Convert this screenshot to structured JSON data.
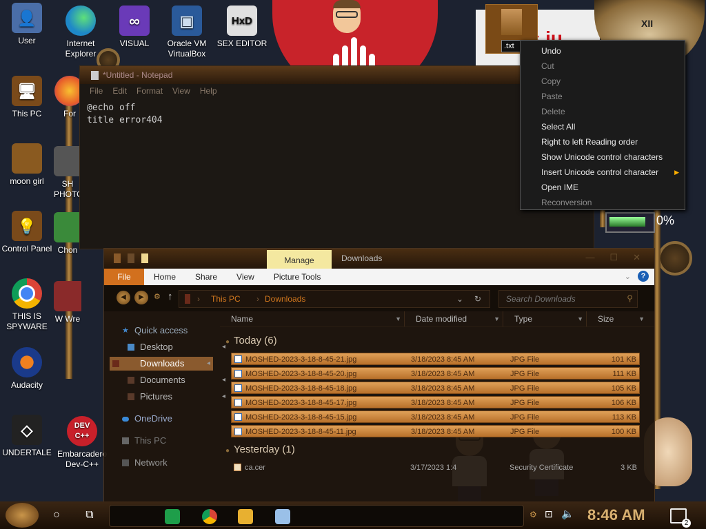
{
  "desktop": {
    "icons": [
      {
        "label": "User",
        "glyph": "👤",
        "color": "#4a6ea8"
      },
      {
        "label": "This PC",
        "glyph": "🖥",
        "color": "#7a4a1a"
      },
      {
        "label": "moon girl",
        "glyph": "",
        "color": "#8a5a20"
      },
      {
        "label": "Control Panel",
        "glyph": "💡",
        "color": "#7a4a1a"
      },
      {
        "label": "THIS IS SPYWARE",
        "glyph": "",
        "color": "#ffffff"
      },
      {
        "label": "Audacity",
        "glyph": "",
        "color": "#1a3a8a"
      },
      {
        "label": "UNDERTALE",
        "glyph": "",
        "color": "#222222"
      },
      {
        "label": "Internet Explorer",
        "glyph": "",
        "color": "#1e88c8"
      },
      {
        "label": "VISUAL",
        "glyph": "∞",
        "color": "#6a3ab8"
      },
      {
        "label": "Oracle VM VirtualBox",
        "glyph": "▣",
        "color": "#2a5a9a"
      },
      {
        "label": "SEX EDITOR",
        "glyph": "HxD",
        "color": "#e0e0e0"
      },
      {
        "label": "For",
        "glyph": "",
        "color": "#e8602a"
      },
      {
        "label": "SH PHOTO",
        "glyph": "",
        "color": "#555555"
      },
      {
        "label": "Chon",
        "glyph": "",
        "color": "#3a8a3a"
      },
      {
        "label": "W Wre",
        "glyph": "",
        "color": "#8a2a2a"
      },
      {
        "label": "Embarcadero Dev-C++",
        "glyph": "DEV C++",
        "color": "#c8202a"
      }
    ],
    "meter_percent": "0%"
  },
  "notepad": {
    "title": "*Untitled - Notepad",
    "menu": [
      "File",
      "Edit",
      "Format",
      "View",
      "Help"
    ],
    "content": "@echo off\ntitle error404"
  },
  "rename": {
    "value": ".txt"
  },
  "context_menu": {
    "items": [
      {
        "label": "Undo",
        "enabled": true,
        "submenu": false
      },
      {
        "label": "Cut",
        "enabled": false,
        "submenu": false
      },
      {
        "label": "Copy",
        "enabled": false,
        "submenu": false
      },
      {
        "label": "Paste",
        "enabled": false,
        "submenu": false
      },
      {
        "label": "Delete",
        "enabled": false,
        "submenu": false
      },
      {
        "label": "Select All",
        "enabled": true,
        "submenu": false
      },
      {
        "label": "Right to left Reading order",
        "enabled": true,
        "submenu": false
      },
      {
        "label": "Show Unicode control characters",
        "enabled": true,
        "submenu": false
      },
      {
        "label": "Insert Unicode control character",
        "enabled": true,
        "submenu": true
      },
      {
        "label": "Open IME",
        "enabled": true,
        "submenu": false
      },
      {
        "label": "Reconversion",
        "enabled": false,
        "submenu": false
      }
    ]
  },
  "explorer": {
    "context_tab": "Manage",
    "title": "Downloads",
    "ribbon_tabs": [
      "File",
      "Home",
      "Share",
      "View",
      "Picture Tools"
    ],
    "breadcrumb": [
      "This PC",
      "Downloads"
    ],
    "search_placeholder": "Search Downloads",
    "nav": {
      "quick_access": "Quick access",
      "desktop": "Desktop",
      "downloads": "Downloads",
      "documents": "Documents",
      "pictures": "Pictures",
      "onedrive": "OneDrive",
      "this_pc": "This PC",
      "network": "Network"
    },
    "columns": [
      "Name",
      "Date modified",
      "Type",
      "Size"
    ],
    "groups": [
      {
        "label": "Today (6)",
        "files": [
          {
            "name": "MOSHED-2023-3-18-8-45-21.jpg",
            "date": "3/18/2023 8:45 AM",
            "type": "JPG File",
            "size": "101 KB"
          },
          {
            "name": "MOSHED-2023-3-18-8-45-20.jpg",
            "date": "3/18/2023 8:45 AM",
            "type": "JPG File",
            "size": "111 KB"
          },
          {
            "name": "MOSHED-2023-3-18-8-45-18.jpg",
            "date": "3/18/2023 8:45 AM",
            "type": "JPG File",
            "size": "105 KB"
          },
          {
            "name": "MOSHED-2023-3-18-8-45-17.jpg",
            "date": "3/18/2023 8:45 AM",
            "type": "JPG File",
            "size": "106 KB"
          },
          {
            "name": "MOSHED-2023-3-18-8-45-15.jpg",
            "date": "3/18/2023 8:45 AM",
            "type": "JPG File",
            "size": "113 KB"
          },
          {
            "name": "MOSHED-2023-3-18-8-45-11.jpg",
            "date": "3/18/2023 8:45 AM",
            "type": "JPG File",
            "size": "100 KB"
          }
        ]
      },
      {
        "label": "Yesterday (1)",
        "files": [
          {
            "name": "ca.cer",
            "date": "3/17/2023 1:4",
            "type": "Security Certificate",
            "size": "3 KB"
          }
        ]
      }
    ]
  },
  "taskbar": {
    "time": "8:46 AM",
    "notifications": "2",
    "apps": [
      {
        "name": "sheets",
        "color": "#1e9e4a"
      },
      {
        "name": "chrome",
        "color": "#e0e0e0"
      },
      {
        "name": "file-explorer",
        "color": "#e8b030"
      },
      {
        "name": "notepad",
        "color": "#9ac0e8"
      }
    ]
  }
}
